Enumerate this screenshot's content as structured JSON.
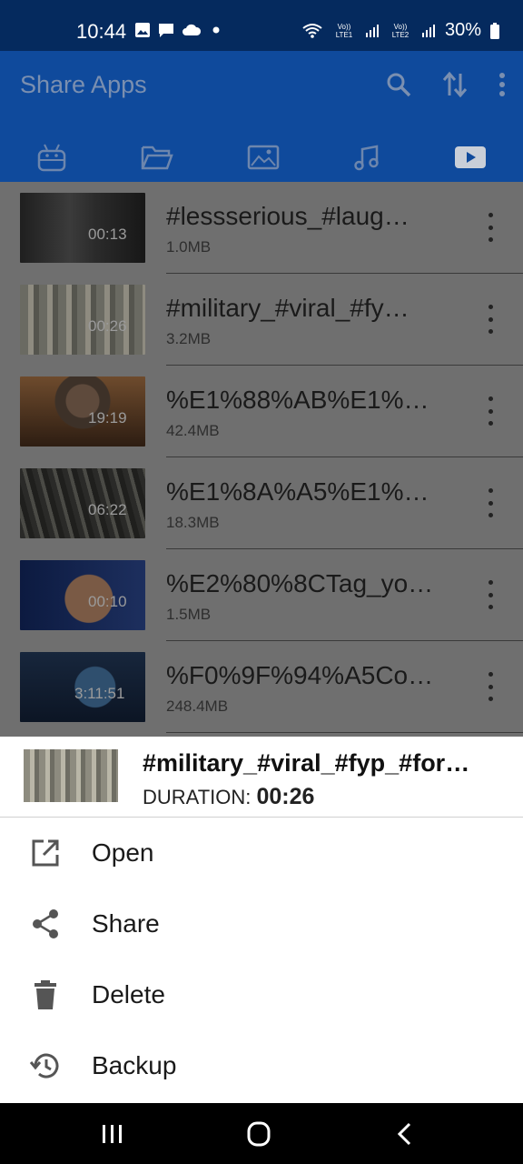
{
  "status_bar": {
    "time": "10:44",
    "battery": "30%",
    "sim1_label": "Vo)) LTE1",
    "sim2_label": "Vo)) LTE2",
    "notification_icons": [
      "gallery-icon",
      "message-icon",
      "cloud-icon",
      "dot-icon"
    ]
  },
  "app_bar": {
    "title": "Share Apps",
    "actions": [
      "search-icon",
      "sort-icon",
      "more-vert-icon"
    ],
    "tabs": [
      "android-icon",
      "folder-icon",
      "image-icon",
      "music-icon",
      "video-icon"
    ],
    "active_tab": "video-icon"
  },
  "videos": [
    {
      "name": "#lessserious_#laug…",
      "size": "1.0MB",
      "duration": "00:13"
    },
    {
      "name": "#military_#viral_#fy…",
      "size": "3.2MB",
      "duration": "00:26"
    },
    {
      "name": "%E1%88%AB%E1%8…",
      "size": "42.4MB",
      "duration": "19:19"
    },
    {
      "name": "%E1%8A%A5%E1%8…",
      "size": "18.3MB",
      "duration": "06:22"
    },
    {
      "name": "%E2%80%8CTag_yo…",
      "size": "1.5MB",
      "duration": "00:10"
    },
    {
      "name": "%F0%9F%94%A5Co…",
      "size": "248.4MB",
      "duration": "3:11:51"
    }
  ],
  "bottom_sheet": {
    "title": "#military_#viral_#fyp_#for…",
    "duration_label": "DURATION:",
    "duration_value": "00:26",
    "actions": [
      {
        "label": "Open",
        "icon": "open-external-icon"
      },
      {
        "label": "Share",
        "icon": "share-icon"
      },
      {
        "label": "Delete",
        "icon": "delete-icon"
      },
      {
        "label": "Backup",
        "icon": "backup-restore-icon"
      }
    ]
  },
  "colors": {
    "status_bar": "#052a5e",
    "app_bar": "#0f4a9c",
    "scrim_list": "#6f6f6f"
  }
}
